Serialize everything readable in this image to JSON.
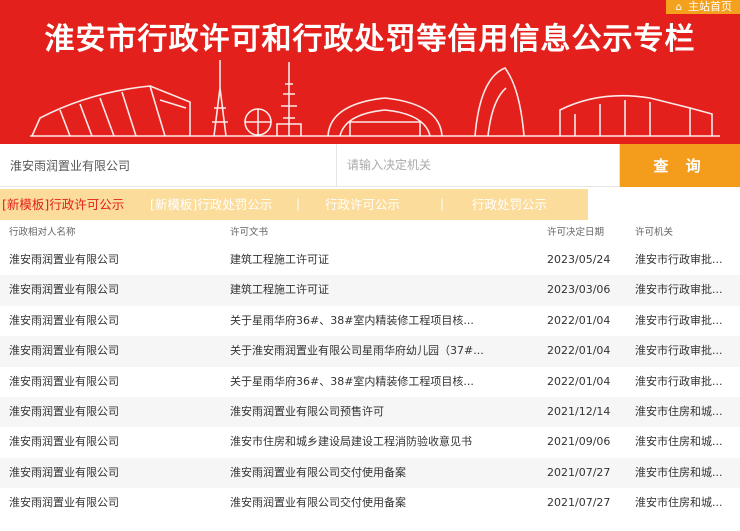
{
  "header": {
    "home_link": "主站首页",
    "title": "淮安市行政许可和行政处罚等信用信息公示专栏"
  },
  "search": {
    "name_value": "淮安雨润置业有限公司",
    "authority_placeholder": "请输入决定机关",
    "button_label": "查 询"
  },
  "tabs": [
    {
      "label": "[新模板]行政许可公示",
      "active": true
    },
    {
      "label": "[新模板]行政处罚公示",
      "active": false
    },
    {
      "label": "行政许可公示",
      "active": false
    },
    {
      "label": "行政处罚公示",
      "active": false
    }
  ],
  "tab_separator": "|",
  "table": {
    "headers": [
      "行政相对人名称",
      "许可文书",
      "许可决定日期",
      "许可机关"
    ],
    "rows": [
      [
        "淮安雨润置业有限公司",
        "建筑工程施工许可证",
        "2023/05/24",
        "淮安市行政审批..."
      ],
      [
        "淮安雨润置业有限公司",
        "建筑工程施工许可证",
        "2023/03/06",
        "淮安市行政审批..."
      ],
      [
        "淮安雨润置业有限公司",
        "关于星雨华府36#、38#室内精装修工程项目核...",
        "2022/01/04",
        "淮安市行政审批..."
      ],
      [
        "淮安雨润置业有限公司",
        "关于淮安雨润置业有限公司星雨华府幼儿园（37#...",
        "2022/01/04",
        "淮安市行政审批..."
      ],
      [
        "淮安雨润置业有限公司",
        "关于星雨华府36#、38#室内精装修工程项目核...",
        "2022/01/04",
        "淮安市行政审批..."
      ],
      [
        "淮安雨润置业有限公司",
        "淮安雨润置业有限公司预售许可",
        "2021/12/14",
        "淮安市住房和城..."
      ],
      [
        "淮安雨润置业有限公司",
        "淮安市住房和城乡建设局建设工程消防验收意见书",
        "2021/09/06",
        "淮安市住房和城..."
      ],
      [
        "淮安雨润置业有限公司",
        "淮安雨润置业有限公司交付使用备案",
        "2021/07/27",
        "淮安市住房和城..."
      ],
      [
        "淮安雨润置业有限公司",
        "淮安雨润置业有限公司交付使用备案",
        "2021/07/27",
        "淮安市住房和城..."
      ]
    ]
  },
  "colors": {
    "banner_red": "#e3201b",
    "accent_orange": "#f49c1b",
    "tab_strip": "#fbdc9b"
  }
}
